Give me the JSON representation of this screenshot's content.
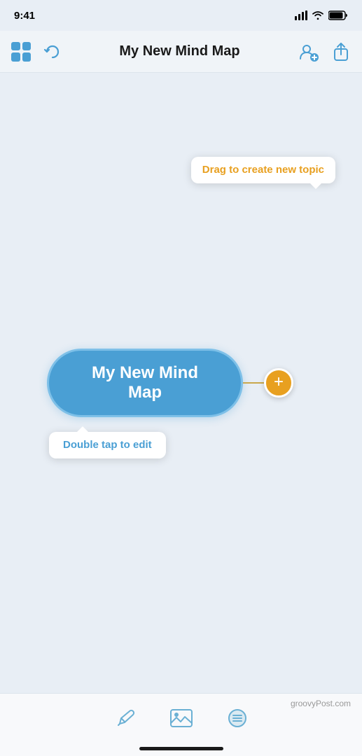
{
  "statusBar": {
    "time": "9:41",
    "icons": [
      "signal",
      "wifi",
      "battery"
    ]
  },
  "navBar": {
    "title": "My New Mind Map",
    "undoLabel": "↩",
    "addUserLabel": "Add collaborator",
    "shareLabel": "Share"
  },
  "canvas": {
    "nodeText": "My New Mind Map",
    "tooltipDrag": "Drag to create new topic",
    "tooltipDoubleTap": "Double tap to edit"
  },
  "toolbar": {
    "penLabel": "Pen tool",
    "imageLabel": "Image tool",
    "menuLabel": "Menu"
  },
  "watermark": "groovyPost.com"
}
